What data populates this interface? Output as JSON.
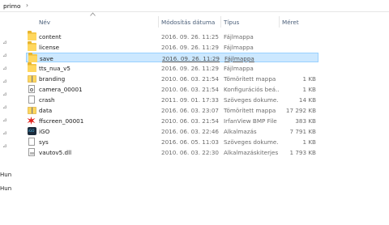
{
  "breadcrumb": {
    "label": "primo",
    "chevron": "›"
  },
  "nav_pane": {
    "items": [
      "Hun",
      "Hun"
    ],
    "pin_count": 9
  },
  "columns": {
    "name": "Név",
    "date": "Módosítás dátuma",
    "type": "Típus",
    "size": "Méret"
  },
  "files": [
    {
      "name": "content",
      "date": "2016. 09. 26. 11:25",
      "type": "Fájlmappa",
      "size": "",
      "icon": "folder-icon"
    },
    {
      "name": "license",
      "date": "2016. 09. 26. 11:29",
      "type": "Fájlmappa",
      "size": "",
      "icon": "folder-icon"
    },
    {
      "name": "save",
      "date": "2016. 09. 26. 11:29",
      "type": "Fájlmappa",
      "size": "",
      "icon": "folder-icon",
      "selected": true
    },
    {
      "name": "tts_nua_v5",
      "date": "2016. 09. 26. 11:29",
      "type": "Fájlmappa",
      "size": "",
      "icon": "folder-icon"
    },
    {
      "name": "branding",
      "date": "2010. 06. 03. 21:54",
      "type": "Tömörített mappa",
      "size": "1 KB",
      "icon": "zip-icon"
    },
    {
      "name": "camera_00001",
      "date": "2010. 06. 03. 21:54",
      "type": "Konfigurációs beá...",
      "size": "1 KB",
      "icon": "config-file-icon"
    },
    {
      "name": "crash",
      "date": "2011. 09. 01. 17:33",
      "type": "Szöveges dokume...",
      "size": "14 KB",
      "icon": "text-file-icon"
    },
    {
      "name": "data",
      "date": "2016. 06. 03. 23:07",
      "type": "Tömörített mappa",
      "size": "17 292 KB",
      "icon": "zip-icon"
    },
    {
      "name": "ffscreen_00001",
      "date": "2010. 06. 03. 21:54",
      "type": "IrfanView BMP File",
      "size": "383 KB",
      "icon": "irfanview-icon"
    },
    {
      "name": "iGO",
      "date": "2016. 06. 03. 22:46",
      "type": "Alkalmazás",
      "size": "7 791 KB",
      "icon": "igo-app-icon"
    },
    {
      "name": "sys",
      "date": "2016. 06. 05. 11:03",
      "type": "Szöveges dokume...",
      "size": "1 KB",
      "icon": "text-file-icon"
    },
    {
      "name": "vautov5.dll",
      "date": "2010. 06. 03. 22:30",
      "type": "Alkalmazáskiterjes...",
      "size": "1 793 KB",
      "icon": "dll-file-icon"
    }
  ],
  "colors": {
    "selection_bg": "#cce8ff",
    "selection_border": "#99d1ff",
    "header_text": "#4c607a",
    "folder": "#ffd75e"
  }
}
